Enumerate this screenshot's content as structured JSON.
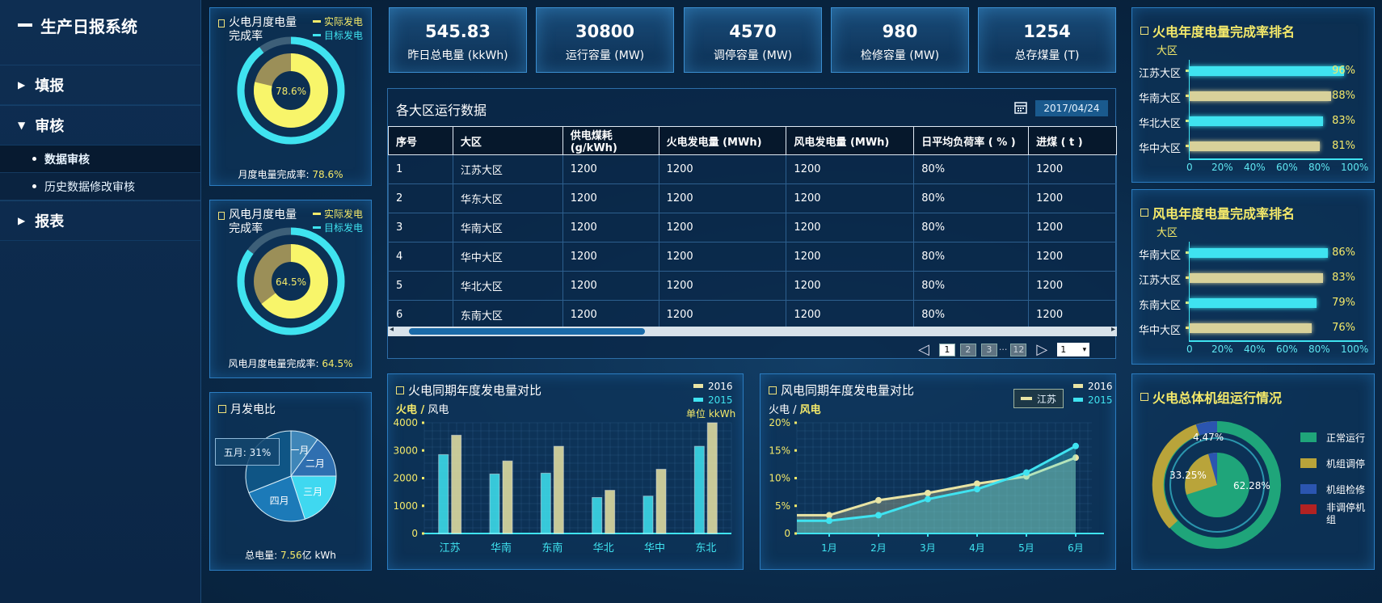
{
  "sidebar": {
    "title": "生产日报系统",
    "items": [
      {
        "label": "填报",
        "arrow": "▶"
      },
      {
        "label": "审核",
        "arrow": "▼"
      },
      {
        "label": "报表",
        "arrow": "▶"
      }
    ],
    "sub_items": [
      {
        "label": "数据审核"
      },
      {
        "label": "历史数据修改审核"
      }
    ]
  },
  "fire_month": {
    "title": "火电月度电量完成率",
    "legend_actual": "实际发电",
    "legend_target": "目标发电",
    "center": "78.6%",
    "footer_label": "月度电量完成率: ",
    "footer_value": "78.6%",
    "value": 0.786
  },
  "wind_month": {
    "title": "风电月度电量完成率",
    "legend_actual": "实际发电",
    "legend_target": "目标发电",
    "center": "64.5%",
    "footer_label": "风电月度电量完成率: ",
    "footer_value": "64.5%",
    "value": 0.645
  },
  "pie": {
    "title": "月发电比",
    "callout": "五月: 31%",
    "slices": [
      {
        "label": "一月",
        "value": 10,
        "color": "#3f86b8"
      },
      {
        "label": "二月",
        "value": 15,
        "color": "#2f6fb0"
      },
      {
        "label": "三月",
        "value": 20,
        "color": "#3fd8f0"
      },
      {
        "label": "四月",
        "value": 24,
        "color": "#1c7ab8"
      },
      {
        "label": "",
        "value": 31,
        "color": "#0f5585"
      }
    ],
    "footer_label": "总电量: ",
    "footer_value": "7.56",
    "footer_unit": "亿 kWh"
  },
  "kpis": [
    {
      "value": "545.83",
      "label": "昨日总电量 (kkWh)"
    },
    {
      "value": "30800",
      "label": "运行容量 (MW)"
    },
    {
      "value": "4570",
      "label": "调停容量 (MW)"
    },
    {
      "value": "980",
      "label": "检修容量 (MW)"
    },
    {
      "value": "1254",
      "label": "总存煤量 (T)"
    }
  ],
  "table": {
    "title": "各大区运行数据",
    "date": "2017/04/24",
    "headers": [
      "序号",
      "大区",
      "供电煤耗 (g/kWh)",
      "火电发电量 (MWh)",
      "风电发电量 (MWh)",
      "日平均负荷率 ( % )",
      "进煤 ( t )"
    ],
    "rows": [
      [
        "1",
        "江苏大区",
        "1200",
        "1200",
        "1200",
        "80%",
        "1200"
      ],
      [
        "2",
        "华东大区",
        "1200",
        "1200",
        "1200",
        "80%",
        "1200"
      ],
      [
        "3",
        "华南大区",
        "1200",
        "1200",
        "1200",
        "80%",
        "1200"
      ],
      [
        "4",
        "华中大区",
        "1200",
        "1200",
        "1200",
        "80%",
        "1200"
      ],
      [
        "5",
        "华北大区",
        "1200",
        "1200",
        "1200",
        "80%",
        "1200"
      ],
      [
        "6",
        "东南大区",
        "1200",
        "1200",
        "1200",
        "80%",
        "1200"
      ]
    ],
    "pages": [
      "1",
      "2",
      "3",
      "12"
    ],
    "ellipsis": "···",
    "page_select": "1",
    "prev": "◁",
    "next": "▷",
    "scroll_left": "◂",
    "scroll_right": "▸",
    "select_arrow": "▾"
  },
  "fire_rank": {
    "title": "火电年度电量完成率排名",
    "subtitle": "大区"
  },
  "wind_rank": {
    "title": "风电年度电量完成率排名",
    "subtitle": "大区"
  },
  "unit_status": {
    "title": "火电总体机组运行情况",
    "outer_label": "33.25%",
    "top_label": "4.47%",
    "inner_label": "62.28%",
    "legend": [
      {
        "label": "正常运行",
        "color": "#1fa57a"
      },
      {
        "label": "机组调停",
        "color": "#b9a43a"
      },
      {
        "label": "机组检修",
        "color": "#2b55b0"
      },
      {
        "label": "非调停机组",
        "color": "#b22222"
      }
    ]
  },
  "fire_compare": {
    "title": "火电同期年度发电量对比",
    "sub_a": "火电 /",
    "sub_b": "风电",
    "unit": "单位 kkWh"
  },
  "wind_compare": {
    "title": "风电同期年度发电量对比",
    "sub_a": "火电 /",
    "sub_b": "风电",
    "region_button": "江苏"
  },
  "chart_data": [
    {
      "type": "bar",
      "name": "fire_rank",
      "categories": [
        "江苏大区",
        "华南大区",
        "华北大区",
        "华中大区"
      ],
      "values": [
        96,
        88,
        83,
        81
      ],
      "labels": [
        "96%",
        "88%",
        "83%",
        "81%"
      ],
      "colors": [
        "#3fe3f0",
        "#d8d19a",
        "#3fe3f0",
        "#d8d19a"
      ],
      "xticks": [
        "0",
        "20%",
        "40%",
        "60%",
        "80%",
        "100%"
      ],
      "xlim": [
        0,
        100
      ]
    },
    {
      "type": "bar",
      "name": "wind_rank",
      "categories": [
        "华南大区",
        "江苏大区",
        "东南大区",
        "华中大区"
      ],
      "values": [
        86,
        83,
        79,
        76
      ],
      "labels": [
        "86%",
        "83%",
        "79%",
        "76%"
      ],
      "colors": [
        "#3fe3f0",
        "#d8d19a",
        "#3fe3f0",
        "#d8d19a"
      ],
      "xticks": [
        "0",
        "20%",
        "40%",
        "60%",
        "80%",
        "100%"
      ],
      "xlim": [
        0,
        100
      ]
    },
    {
      "type": "bar",
      "name": "fire_compare",
      "categories": [
        "江苏",
        "华南",
        "东南",
        "华北",
        "华中",
        "东北"
      ],
      "series": [
        {
          "name": "2015",
          "values": [
            2850,
            2150,
            2180,
            1300,
            1350,
            3150
          ],
          "color": "#3fe3f0"
        },
        {
          "name": "2016",
          "values": [
            3550,
            2620,
            3150,
            1560,
            2320,
            4000
          ],
          "color": "#e9e4a4"
        }
      ],
      "ylim": [
        0,
        4000
      ],
      "yticks": [
        "0",
        "1000",
        "2000",
        "3000",
        "4000"
      ]
    },
    {
      "type": "area",
      "name": "wind_compare",
      "categories": [
        "1月",
        "2月",
        "3月",
        "4月",
        "5月",
        "6月"
      ],
      "series": [
        {
          "name": "2015",
          "values": [
            2.3,
            3.3,
            6.2,
            8.0,
            11.0,
            15.8
          ],
          "color": "#3fe3f0"
        },
        {
          "name": "2016",
          "values": [
            3.3,
            6.0,
            7.3,
            9.0,
            10.3,
            13.7
          ],
          "color": "#e9e4a4"
        }
      ],
      "ylim": [
        0,
        20
      ],
      "yticks": [
        "0",
        "5%",
        "10%",
        "15%",
        "20%"
      ]
    }
  ]
}
